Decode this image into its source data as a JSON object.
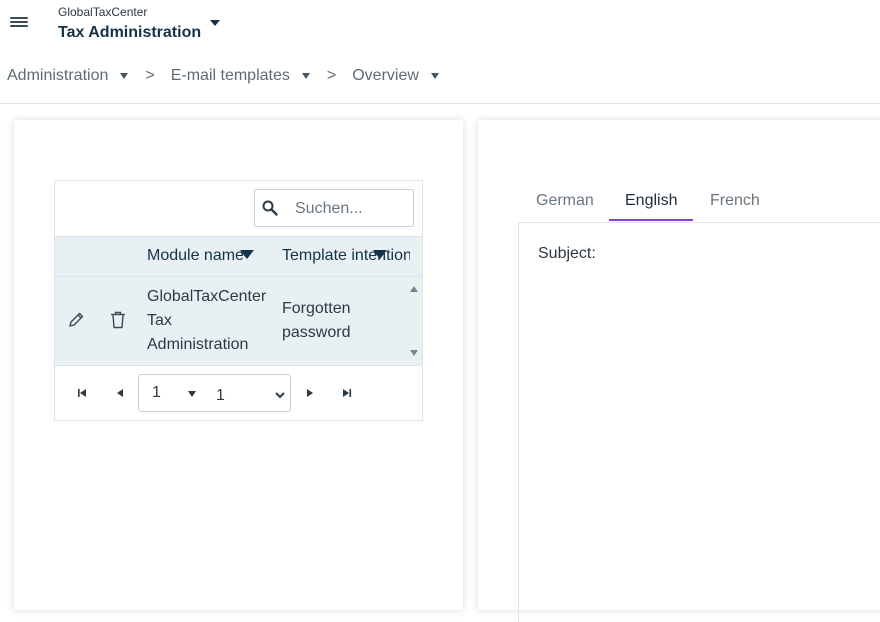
{
  "app": {
    "small_title": "GlobalTaxCenter",
    "large_title": "Tax Administration"
  },
  "breadcrumb": [
    {
      "label": "Administration"
    },
    {
      "label": "E-mail templates"
    },
    {
      "label": "Overview"
    }
  ],
  "breadcrumb_separator": ">",
  "grid": {
    "search_placeholder": "Suchen...",
    "columns": [
      "Module name",
      "Template intention"
    ],
    "rows": [
      {
        "module_name": "GlobalTaxCenter Tax Administration",
        "template_intention": "Forgotten password"
      }
    ],
    "pager": {
      "current_page": "1",
      "page_size": "1",
      "page_size_options": [
        "1"
      ]
    }
  },
  "tabs": [
    {
      "label": "German",
      "active": false
    },
    {
      "label": "English",
      "active": true
    },
    {
      "label": "French",
      "active": false
    }
  ],
  "editor": {
    "subject_label": "Subject:"
  },
  "colors": {
    "accent": "#8a3fd6",
    "header_text": "#163247",
    "grid_header_bg": "#e8f0f3"
  }
}
